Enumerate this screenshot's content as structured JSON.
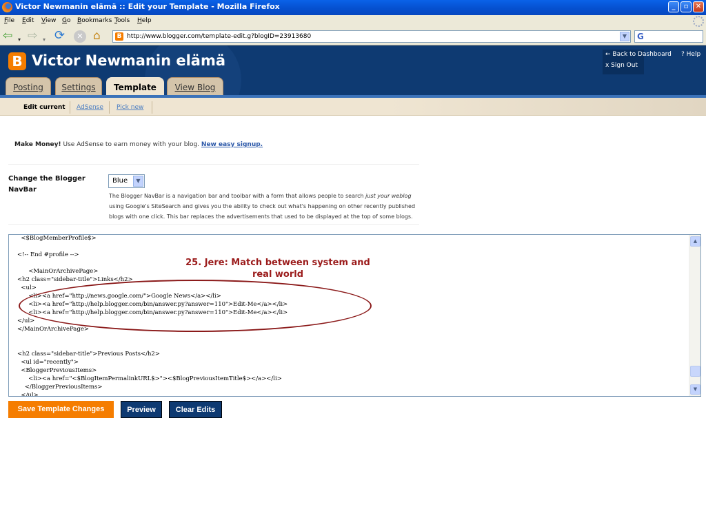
{
  "window": {
    "title": "Victor Newmanin elämä :: Edit your Template - Mozilla Firefox",
    "min": "_",
    "max": "▫",
    "close": "✕"
  },
  "menu": [
    "File",
    "Edit",
    "View",
    "Go",
    "Bookmarks",
    "Tools",
    "Help"
  ],
  "toolbar": {
    "url": "http://www.blogger.com/template-edit.g?blogID=23913680",
    "search_glyph": "G"
  },
  "blogger": {
    "logo_letter": "B",
    "blog_title": "Victor Newmanin elämä",
    "links": {
      "back": "← Back to Dashboard",
      "help": "? Help",
      "signout": "x Sign Out"
    },
    "tabs": [
      "Posting",
      "Settings",
      "Template",
      "View Blog"
    ],
    "subtabs": [
      "Edit current",
      "AdSense",
      "Pick new"
    ]
  },
  "adsense_promo": {
    "lead": "Make Money!",
    "text": " Use AdSense to earn money with your blog. ",
    "link": "New easy signup."
  },
  "navbar_setting": {
    "label": "Change the Blogger NavBar",
    "selected": "Blue",
    "description_parts": [
      "The Blogger NavBar is a navigation bar and toolbar with a form that allows people to search ",
      "just your weblog",
      " using Google's SiteSearch and gives you the ability to check out what's happening on other recently published blogs with one click. This bar replaces the advertisements that used to be displayed at the top of some blogs."
    ]
  },
  "template_code": "  <$BlogMemberProfile$>\n\n<!-- End #profile -->\n\n      <MainOrArchivePage>\n<h2 class=\"sidebar-title\">Links</h2>\n  <ul>\n      <li><a href=\"http://news.google.com/\">Google News</a></li>\n      <li><a href=\"http://help.blogger.com/bin/answer.py?answer=110\">Edit-Me</a></li>\n      <li><a href=\"http://help.blogger.com/bin/answer.py?answer=110\">Edit-Me</a></li>\n</ul>\n</MainOrArchivePage>\n\n\n<h2 class=\"sidebar-title\">Previous Posts</h2>\n  <ul id=\"recently\">\n  <BloggerPreviousItems>\n      <li><a href=\"<$BlogItemPermalinkURL$>\"><$BlogPreviousItemTitle$></a></li>\n    </BloggerPreviousItems>\n  </ul>",
  "annotation": "25. Jere: Match between system and real world",
  "buttons": {
    "save": "Save Template Changes",
    "preview": "Preview",
    "clear": "Clear Edits"
  },
  "colors": {
    "blogger_orange": "#f57d00",
    "header_navy": "#0e3a72",
    "annotation_red": "#9b1b1b"
  }
}
